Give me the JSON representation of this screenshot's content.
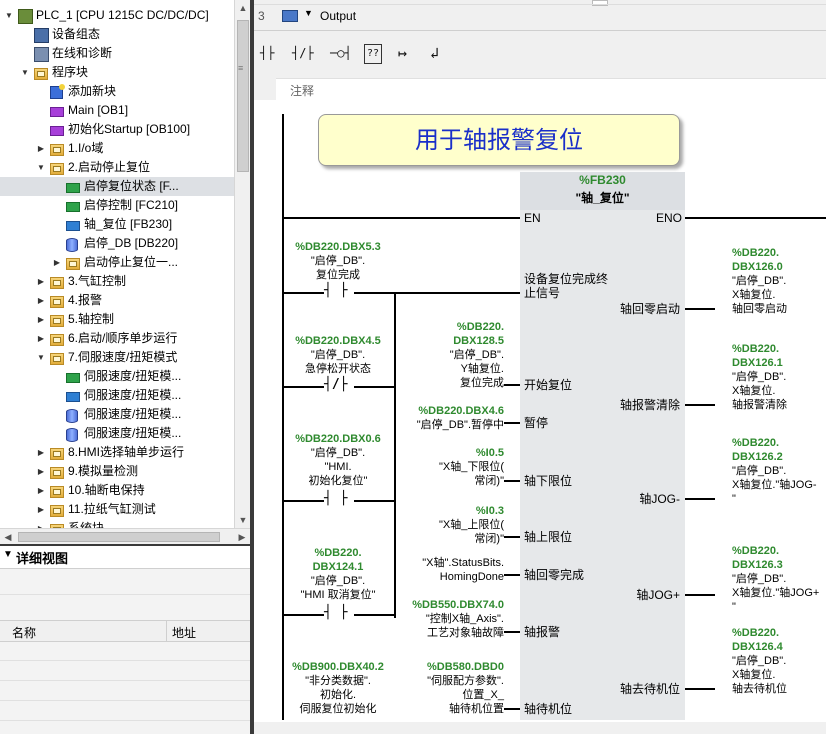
{
  "tree": {
    "items": [
      {
        "label": "PLC_1 [CPU 1215C DC/DC/DC]",
        "icon": "cpu-icon",
        "kind": "cpu",
        "level": 1,
        "expand": "open"
      },
      {
        "label": "设备组态",
        "icon": "device-config-icon",
        "kind": "cfg",
        "level": 2,
        "expand": "none"
      },
      {
        "label": "在线和诊断",
        "icon": "online-diagnostics-icon",
        "kind": "diag",
        "level": 2,
        "expand": "none"
      },
      {
        "label": "程序块",
        "icon": "folder-icon",
        "kind": "folder",
        "level": 2,
        "expand": "open"
      },
      {
        "label": "添加新块",
        "icon": "add-block-icon",
        "kind": "add",
        "level": 3,
        "expand": "none"
      },
      {
        "label": "Main [OB1]",
        "icon": "ob-block-icon",
        "kind": "ob",
        "level": 3,
        "expand": "none"
      },
      {
        "label": "初始化Startup [OB100]",
        "icon": "ob-block-icon",
        "kind": "ob",
        "level": 3,
        "expand": "none"
      },
      {
        "label": "1.I/o域",
        "icon": "folder-icon",
        "kind": "folder",
        "level": 3,
        "expand": "closed"
      },
      {
        "label": "2.启动停止复位",
        "icon": "folder-icon",
        "kind": "folder",
        "level": 3,
        "expand": "open"
      },
      {
        "label": "启停复位状态 [F...",
        "icon": "fc-block-icon",
        "kind": "fc",
        "level": 4,
        "expand": "none",
        "selected": true
      },
      {
        "label": "启停控制 [FC210]",
        "icon": "fc-block-icon",
        "kind": "fc",
        "level": 4,
        "expand": "none"
      },
      {
        "label": "轴_复位 [FB230]",
        "icon": "fb-block-icon",
        "kind": "fb",
        "level": 4,
        "expand": "none"
      },
      {
        "label": "启停_DB [DB220]",
        "icon": "db-block-icon",
        "kind": "db",
        "level": 4,
        "expand": "none"
      },
      {
        "label": "启动停止复位一...",
        "icon": "folder-icon",
        "kind": "folder",
        "level": 4,
        "expand": "closed"
      },
      {
        "label": "3.气缸控制",
        "icon": "folder-icon",
        "kind": "folder",
        "level": 3,
        "expand": "closed"
      },
      {
        "label": "4.报警",
        "icon": "folder-icon",
        "kind": "folder",
        "level": 3,
        "expand": "closed"
      },
      {
        "label": "5.轴控制",
        "icon": "folder-icon",
        "kind": "folder",
        "level": 3,
        "expand": "closed"
      },
      {
        "label": "6.启动/顺序单步运行",
        "icon": "folder-icon",
        "kind": "folder",
        "level": 3,
        "expand": "closed"
      },
      {
        "label": "7.伺服速度/扭矩模式",
        "icon": "folder-icon",
        "kind": "folder",
        "level": 3,
        "expand": "open"
      },
      {
        "label": "伺服速度/扭矩模...",
        "icon": "fc-block-icon",
        "kind": "fc",
        "level": 4,
        "expand": "none"
      },
      {
        "label": "伺服速度/扭矩模...",
        "icon": "fb-block-icon",
        "kind": "fb",
        "level": 4,
        "expand": "none"
      },
      {
        "label": "伺服速度/扭矩模...",
        "icon": "db-block-icon",
        "kind": "db",
        "level": 4,
        "expand": "none"
      },
      {
        "label": "伺服速度/扭矩模...",
        "icon": "db-block-icon",
        "kind": "db",
        "level": 4,
        "expand": "none"
      },
      {
        "label": "8.HMI选择轴单步运行",
        "icon": "folder-icon",
        "kind": "folder",
        "level": 3,
        "expand": "closed"
      },
      {
        "label": "9.模拟量检测",
        "icon": "folder-icon",
        "kind": "folder",
        "level": 3,
        "expand": "closed"
      },
      {
        "label": "10.轴断电保持",
        "icon": "folder-icon",
        "kind": "folder",
        "level": 3,
        "expand": "closed"
      },
      {
        "label": "11.拉纸气缸测试",
        "icon": "folder-icon",
        "kind": "folder",
        "level": 3,
        "expand": "closed"
      },
      {
        "label": "系统块",
        "icon": "folder-icon",
        "kind": "folder",
        "level": 3,
        "expand": "closed"
      }
    ]
  },
  "detail_view": {
    "title": "详细视图",
    "col_name": "名称",
    "col_address": "地址"
  },
  "editor": {
    "tab_row_number": "3",
    "tab_output_label": "Output",
    "toolbar": {
      "no_contact": "┤├",
      "nc_contact": "┤/├",
      "coil": "─○┤",
      "empty_box": "??",
      "open_branch": "↦",
      "close_branch": "↲"
    },
    "comment_label": "注释",
    "network_title": "用于轴报警复位",
    "fb": {
      "address": "%FB230",
      "name": "\"轴_复位\"",
      "en": "EN",
      "eno": "ENO",
      "inputs": [
        {
          "pin": "设备复位完成终止信号",
          "pin_line2": "止信号",
          "pin_line1": "设备复位完成终"
        },
        {
          "pin": "开始复位"
        },
        {
          "pin": "暂停"
        },
        {
          "pin": "轴下限位"
        },
        {
          "pin": "轴上限位"
        },
        {
          "pin": "轴回零完成"
        },
        {
          "pin": "轴报警"
        },
        {
          "pin": "轴待机位"
        }
      ],
      "outputs": [
        {
          "pin": "轴回零启动",
          "addr1": "%DB220.",
          "addr2": "DBX126.0",
          "t1": "\"启停_DB\".",
          "t2": "X轴复位.",
          "t3": "轴回零启动"
        },
        {
          "pin": "轴报警清除",
          "addr1": "%DB220.",
          "addr2": "DBX126.1",
          "t1": "\"启停_DB\".",
          "t2": "X轴复位.",
          "t3": "轴报警清除"
        },
        {
          "pin": "轴JOG-",
          "addr1": "%DB220.",
          "addr2": "DBX126.2",
          "t1": "\"启停_DB\".",
          "t2": "X轴复位.\"轴JOG-",
          "t3": "\""
        },
        {
          "pin": "轴JOG+",
          "addr1": "%DB220.",
          "addr2": "DBX126.3",
          "t1": "\"启停_DB\".",
          "t2": "X轴复位.\"轴JOG+",
          "t3": "\""
        },
        {
          "pin": "轴去待机位",
          "addr1": "%DB220.",
          "addr2": "DBX126.4",
          "t1": "\"启停_DB\".",
          "t2": "X轴复位.",
          "t3": "轴去待机位"
        }
      ]
    },
    "contacts": [
      {
        "addr": "%DB220.DBX5.3",
        "l1": "\"启停_DB\".",
        "l2": "复位完成"
      },
      {
        "addr": "%DB220.DBX4.5",
        "l1": "\"启停_DB\".",
        "l2": "急停松开状态"
      },
      {
        "addr": "%DB220.DBX0.6",
        "l1": "\"启停_DB\".",
        "l2": "\"HMI.",
        "l3": "初始化复位\""
      },
      {
        "addr1": "%DB220.",
        "addr2": "DBX124.1",
        "l1": "\"启停_DB\".",
        "l2": "\"HMI 取消复位\""
      },
      {
        "addr": "%DB900.DBX40.2",
        "l1": "\"非分类数据\".",
        "l2": "初始化.",
        "l3": "伺服复位初始化"
      }
    ],
    "input_operands": [
      {
        "addr1": "%DB220.",
        "addr2": "DBX128.5",
        "l1": "\"启停_DB\".",
        "l2": "Y轴复位.",
        "l3": "复位完成"
      },
      {
        "addr": "%DB220.DBX4.6",
        "l1": "\"启停_DB\".暂停中"
      },
      {
        "addr": "%I0.5",
        "l1": "\"X轴_下限位(",
        "l2": "常闭)\""
      },
      {
        "addr": "%I0.3",
        "l1": "\"X轴_上限位(",
        "l2": "常闭)\""
      },
      {
        "l1": "\"X轴\".StatusBits.",
        "l2": "HomingDone"
      },
      {
        "addr": "%DB550.DBX74.0",
        "l1": "\"控制X轴_Axis\".",
        "l2": "工艺对象轴故障"
      },
      {
        "addr": "%DB580.DBD0",
        "l1": "\"伺服配方参数\".",
        "l2": "位置_X_",
        "l3": "轴待机位置"
      }
    ]
  }
}
